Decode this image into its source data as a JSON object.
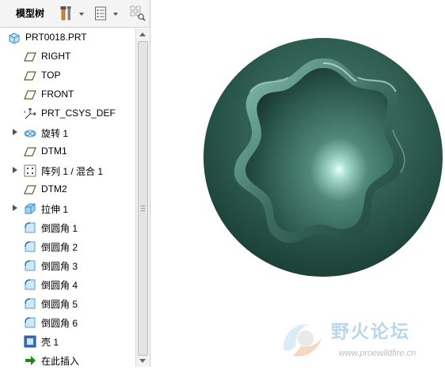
{
  "model_tree": {
    "tab_label": "模型树",
    "items": [
      {
        "label": "PRT0018.PRT",
        "icon": "part-icon",
        "expandable": false
      },
      {
        "label": "RIGHT",
        "icon": "datum-plane-icon",
        "expandable": false
      },
      {
        "label": "TOP",
        "icon": "datum-plane-icon",
        "expandable": false
      },
      {
        "label": "FRONT",
        "icon": "datum-plane-icon",
        "expandable": false
      },
      {
        "label": "PRT_CSYS_DEF",
        "icon": "coordinate-system-icon",
        "expandable": false
      },
      {
        "label": "旋转 1",
        "icon": "revolve-icon",
        "expandable": true
      },
      {
        "label": "DTM1",
        "icon": "datum-plane-icon",
        "expandable": false
      },
      {
        "label": "阵列 1 / 混合 1",
        "icon": "pattern-icon",
        "expandable": true
      },
      {
        "label": "DTM2",
        "icon": "datum-plane-icon",
        "expandable": false
      },
      {
        "label": "拉伸 1",
        "icon": "extrude-icon",
        "expandable": true
      },
      {
        "label": "倒圆角 1",
        "icon": "round-icon",
        "expandable": false
      },
      {
        "label": "倒圆角 2",
        "icon": "round-icon",
        "expandable": false
      },
      {
        "label": "倒圆角 3",
        "icon": "round-icon",
        "expandable": false
      },
      {
        "label": "倒圆角 4",
        "icon": "round-icon",
        "expandable": false
      },
      {
        "label": "倒圆角 5",
        "icon": "round-icon",
        "expandable": false
      },
      {
        "label": "倒圆角 6",
        "icon": "round-icon",
        "expandable": false
      },
      {
        "label": "壳 1",
        "icon": "shell-icon",
        "expandable": false
      },
      {
        "label": "在此插入",
        "icon": "insert-here-icon",
        "expandable": false
      }
    ]
  },
  "toolbar": {
    "icons": [
      "settings-tools-icon",
      "show-options-icon",
      "filter-grid-icon"
    ]
  },
  "watermark": {
    "name": "野火论坛",
    "url": "www.proewildfire.cn"
  },
  "colors": {
    "model_surface": "#2e5b50",
    "model_highlight": "#9ad4c2",
    "datum_plane": "#6a5a2a",
    "part_icon": "#4aa3d8",
    "insert_arrow": "#1a8a1a"
  }
}
